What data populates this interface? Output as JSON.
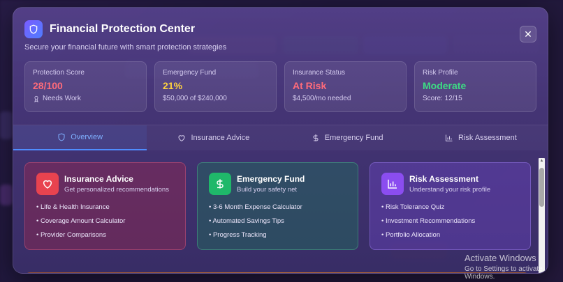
{
  "header": {
    "title": "Financial Protection Center",
    "subtitle": "Secure your financial future with smart protection strategies"
  },
  "stats": [
    {
      "label": "Protection Score",
      "value": "28/100",
      "sub": "Needs Work",
      "color": "#ff6b7a"
    },
    {
      "label": "Emergency Fund",
      "value": "21%",
      "sub": "$50,000 of $240,000",
      "color": "#ffd23f"
    },
    {
      "label": "Insurance Status",
      "value": "At Risk",
      "sub": "$4,500/mo needed",
      "color": "#ff6b7a"
    },
    {
      "label": "Risk Profile",
      "value": "Moderate",
      "sub": "Score: 12/15",
      "color": "#3ddc84"
    }
  ],
  "tabs": [
    {
      "label": "Overview",
      "icon": "shield-icon"
    },
    {
      "label": "Insurance Advice",
      "icon": "heart-icon"
    },
    {
      "label": "Emergency Fund",
      "icon": "dollar-icon"
    },
    {
      "label": "Risk Assessment",
      "icon": "bar-chart-icon"
    }
  ],
  "cards": [
    {
      "title": "Insurance Advice",
      "subtitle": "Get personalized recommendations",
      "items": [
        "Life & Health Insurance",
        "Coverage Amount Calculator",
        "Provider Comparisons"
      ]
    },
    {
      "title": "Emergency Fund",
      "subtitle": "Build your safety net",
      "items": [
        "3-6 Month Expense Calculator",
        "Automated Savings Tips",
        "Progress Tracking"
      ]
    },
    {
      "title": "Risk Assessment",
      "subtitle": "Understand your risk profile",
      "items": [
        "Risk Tolerance Quiz",
        "Investment Recommendations",
        "Portfolio Allocation"
      ]
    }
  ],
  "close_label": "✕",
  "watermark": {
    "title": "Activate Windows",
    "subtitle": "Go to Settings to activate Windows."
  }
}
